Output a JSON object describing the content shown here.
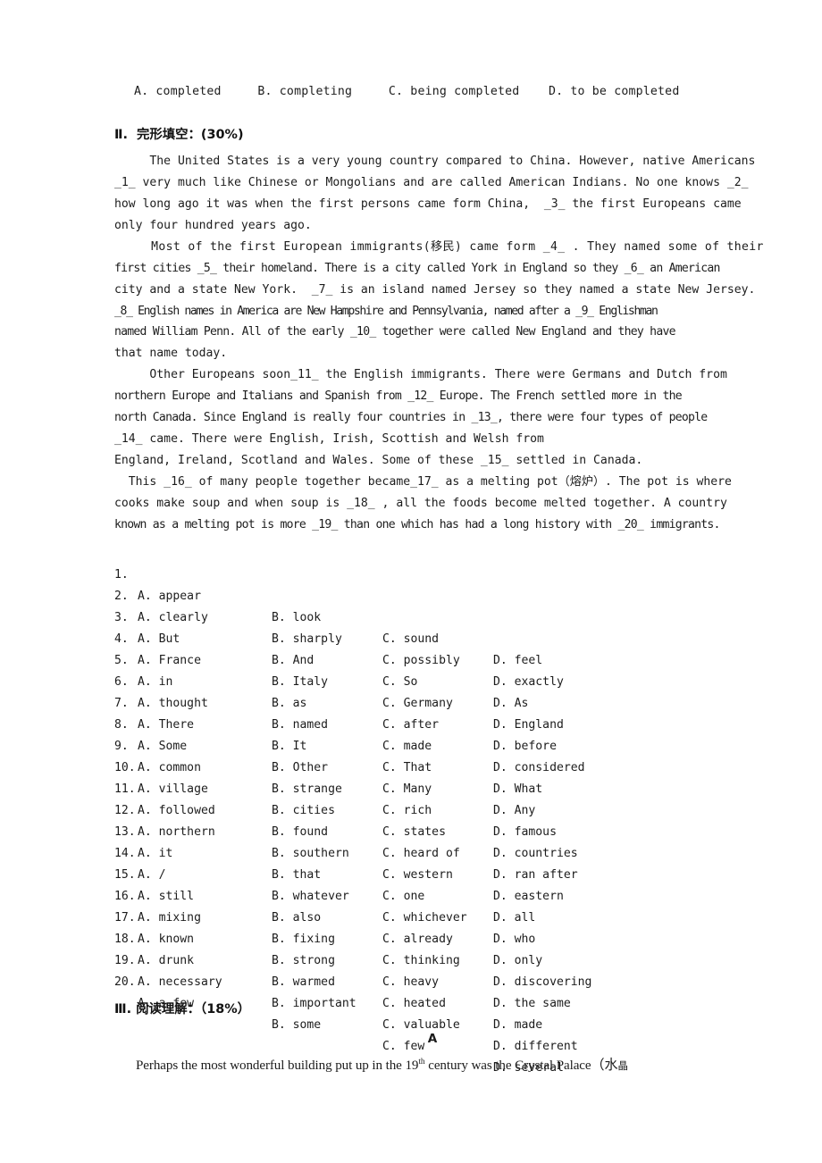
{
  "document": {
    "top_answer_row": "A. completed     B. completing     C. being completed    D. to be completed",
    "section2": {
      "heading": "Ⅱ.  完形填空：(30%)",
      "passage_lines": [
        "     The United States is a very young country compared to China. However, native Americans",
        "_1_ very much like Chinese or Mongolians and are called American Indians. No one knows _2_",
        "how long ago it was when the first persons came form China,  _3_ the first Europeans came",
        "only four hundred years ago.",
        "     Most of the first European immigrants(移民) came form _4_ . They named some of their",
        "first cities _5_ their homeland. There is a city called York in England so they _6_ an American",
        "city and a state New York.  _7_ is an island named Jersey so they named a state New Jersey.",
        "_8_ English names in America are New Hampshire and Pennsylvania, named after a _9_ Englishman",
        "named William Penn. All of the early _10_ together were called New England and they have",
        "that name today.",
        "     Other Europeans soon_11_ the English immigrants. There were Germans and Dutch from",
        "northern Europe and Italians and Spanish from _12_ Europe. The French settled more in the",
        "north Canada. Since England is really four countries in _13_, there were four types of people",
        "_14_ came. There were English, Irish, Scottish and Welsh from",
        "England, Ireland, Scotland and Wales. Some of these _15_ settled in Canada.",
        "  This _16_ of many people together became_17_ as a melting pot（熔炉）. The pot is where",
        "cooks make soup and when soup is _18_ , all the foods become melted together. A country",
        "known as a melting pot is more _19_ than one which has had a long history with _20_ immigrants."
      ],
      "options": [
        {
          "num": "1.",
          "a": "A. appear",
          "b": "B. look",
          "c": "C. sound",
          "d": "D. feel"
        },
        {
          "num": "2.",
          "a": "A. clearly",
          "b": "B. sharply",
          "c": "C. possibly",
          "d": "D. exactly"
        },
        {
          "num": "3.",
          "a": "A. But",
          "b": "B. And",
          "c": "C. So",
          "d": "D. As"
        },
        {
          "num": "4.",
          "a": "A. France",
          "b": "B. Italy",
          "c": "C. Germany",
          "d": "D. England"
        },
        {
          "num": "5.",
          "a": "A. in",
          "b": "B. as",
          "c": "C. after",
          "d": "D. before"
        },
        {
          "num": "6.",
          "a": "A. thought",
          "b": "B. named",
          "c": "C. made",
          "d": "D. considered"
        },
        {
          "num": "7.",
          "a": "A. There",
          "b": "B. It",
          "c": "C. That",
          "d": "D. What"
        },
        {
          "num": "8.",
          "a": "A. Some",
          "b": "B. Other",
          "c": "C. Many",
          "d": "D. Any"
        },
        {
          "num": "9.",
          "a": "A. common",
          "b": "B. strange",
          "c": "C. rich",
          "d": "D. famous"
        },
        {
          "num": "10.",
          "a": "A. village",
          "b": "B. cities",
          "c": "C. states",
          "d": "D. countries"
        },
        {
          "num": "11.",
          "a": "A. followed",
          "b": "B. found",
          "c": "C. heard of",
          "d": "D. ran after"
        },
        {
          "num": "12.",
          "a": "A. northern",
          "b": "B. southern",
          "c": "C. western",
          "d": "D. eastern"
        },
        {
          "num": "13.",
          "a": "A. it",
          "b": "B. that",
          "c": "C. one",
          "d": "D. all"
        },
        {
          "num": "14.",
          "a": "A. /",
          "b": "B. whatever",
          "c": "C. whichever",
          "d": "D. who"
        },
        {
          "num": "15.",
          "a": "A. still",
          "b": "B. also",
          "c": "C. already",
          "d": "D. only"
        },
        {
          "num": "16.",
          "a": "A. mixing",
          "b": "B. fixing",
          "c": "C. thinking",
          "d": "D. discovering"
        },
        {
          "num": "17.",
          "a": "A. known",
          "b": "B. strong",
          "c": "C. heavy",
          "d": "D. the same"
        },
        {
          "num": "18.",
          "a": "A. drunk",
          "b": "B. warmed",
          "c": "C. heated",
          "d": "D. made"
        },
        {
          "num": "19.",
          "a": "A. necessary",
          "b": "B. important",
          "c": "C. valuable",
          "d": "D. different"
        },
        {
          "num": "20.",
          "a": "A. a few",
          "b": "B. some",
          "c": "C. few",
          "d": "D. several"
        }
      ]
    },
    "section3": {
      "heading": "Ⅲ. 阅读理解：（18%）",
      "passage_label": "A",
      "first_line_pre": "Perhaps the most wonderful building put up in the 19",
      "first_line_sup": "th",
      "first_line_post": " century was the Crystal Palace（水",
      "first_line_tail": "晶"
    }
  }
}
